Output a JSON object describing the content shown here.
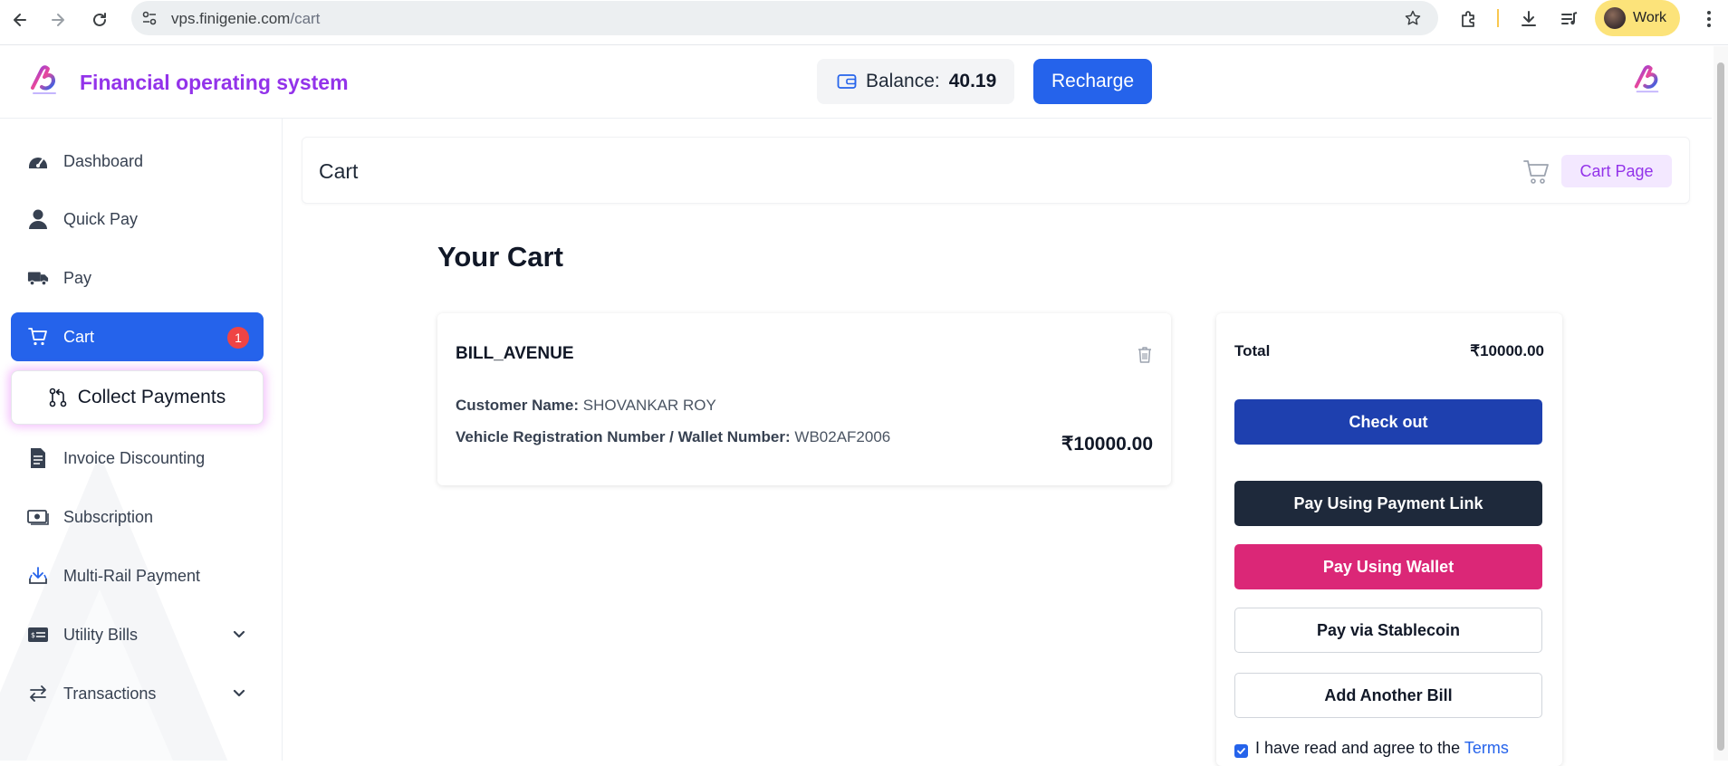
{
  "browser": {
    "url_host": "vps.finigenie.com",
    "url_path": "/cart",
    "profile_label": "Work"
  },
  "header": {
    "brand_name": "Financial operating system",
    "balance_label": "Balance:",
    "balance_value": "40.19",
    "recharge_label": "Recharge"
  },
  "sidebar": {
    "items": [
      {
        "label": "Dashboard",
        "icon": "gauge-icon"
      },
      {
        "label": "Quick Pay",
        "icon": "user-icon"
      },
      {
        "label": "Pay",
        "icon": "truck-icon"
      },
      {
        "label": "Cart",
        "icon": "cart-icon",
        "badge": "1",
        "active": true
      },
      {
        "label": "Invoice Discounting",
        "icon": "invoice-icon"
      },
      {
        "label": "Subscription",
        "icon": "money-icon"
      },
      {
        "label": "Multi-Rail Payment",
        "icon": "download-tray-icon"
      },
      {
        "label": "Utility Bills",
        "icon": "bill-icon"
      },
      {
        "label": "Transactions",
        "icon": "swap-icon"
      }
    ],
    "collect_payments_label": "Collect Payments"
  },
  "page": {
    "title": "Cart",
    "breadcrumb": "Cart Page",
    "heading": "Your Cart"
  },
  "cart_item": {
    "biller": "BILL_AVENUE",
    "customer_label": "Customer Name:",
    "customer_value": "SHOVANKAR ROY",
    "vehicle_label": "Vehicle Registration Number / Wallet Number:",
    "vehicle_value": "WB02AF2006",
    "amount": "₹10000.00"
  },
  "summary": {
    "total_label": "Total",
    "total_value": "₹10000.00",
    "checkout_label": "Check out",
    "payment_link_label": "Pay Using Payment Link",
    "wallet_label": "Pay Using Wallet",
    "stablecoin_label": "Pay via Stablecoin",
    "add_bill_label": "Add Another Bill",
    "terms_text": "I have read and agree to the",
    "terms_link": "Terms",
    "terms_checked": true
  },
  "colors": {
    "primary": "#2563eb",
    "brand": "#9333ea",
    "wallet": "#db2777",
    "dark": "#1e293b",
    "checkout": "#1e40af",
    "badge": "#ef4444"
  }
}
